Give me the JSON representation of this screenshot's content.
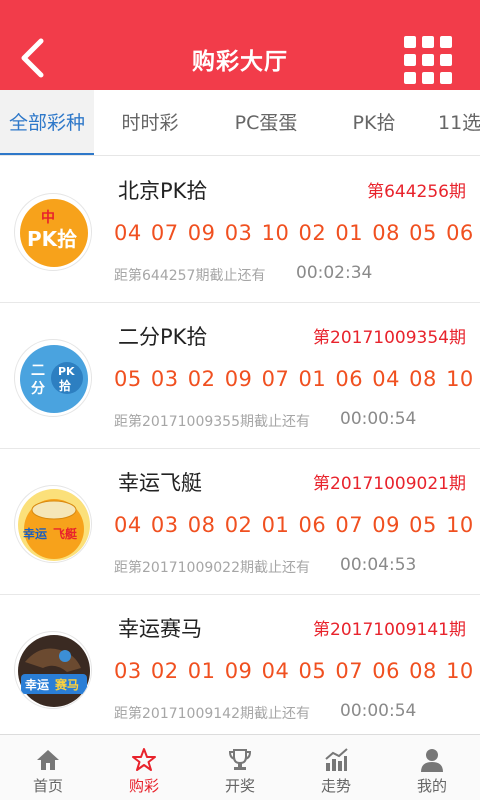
{
  "header": {
    "title": "购彩大厅",
    "back_icon": "chevron-left-icon",
    "grid_icon": "grid-menu-icon"
  },
  "tabs": [
    {
      "label": "全部彩种",
      "active": true
    },
    {
      "label": "时时彩",
      "active": false
    },
    {
      "label": "PC蛋蛋",
      "active": false
    },
    {
      "label": "PK拾",
      "active": false
    },
    {
      "label": "11选",
      "active": false
    }
  ],
  "lotteries": [
    {
      "name": "北京PK拾",
      "period": "第644256期",
      "numbers": "04 07 09 03 10 02 01 08 05 06",
      "countdown_label": "距第644257期截止还有",
      "time_left": "00:02:34",
      "logo_text": [
        "中",
        "PK拾"
      ]
    },
    {
      "name": "二分PK拾",
      "period": "第20171009354期",
      "numbers": "05 03 02 09 07 01 06 04 08 10",
      "countdown_label": "距第20171009355期截止还有",
      "time_left": "00:00:54",
      "logo_text": [
        "二",
        "分",
        "PK",
        "拾"
      ]
    },
    {
      "name": "幸运飞艇",
      "period": "第20171009021期",
      "numbers": "04 03 08 02 01 06 07 09 05 10",
      "countdown_label": "距第20171009022期截止还有",
      "time_left": "00:04:53",
      "logo_text": [
        "幸运",
        "飞艇"
      ]
    },
    {
      "name": "幸运赛马",
      "period": "第20171009141期",
      "numbers": "03 02 01 09 04 05 07 06 08 10",
      "countdown_label": "距第20171009142期截止还有",
      "time_left": "00:00:54",
      "logo_text": [
        "幸运",
        "赛马"
      ]
    }
  ],
  "tabbar": [
    {
      "label": "首页",
      "icon": "home-icon",
      "active": false
    },
    {
      "label": "购彩",
      "icon": "lottery-icon",
      "active": true
    },
    {
      "label": "开奖",
      "icon": "trophy-icon",
      "active": false
    },
    {
      "label": "走势",
      "icon": "trend-icon",
      "active": false
    },
    {
      "label": "我的",
      "icon": "user-icon",
      "active": false
    }
  ],
  "colors": {
    "header": "#f23c4a",
    "accent_red": "#e8232c",
    "number_orange": "#f05020",
    "tab_active": "#2e78c9"
  }
}
